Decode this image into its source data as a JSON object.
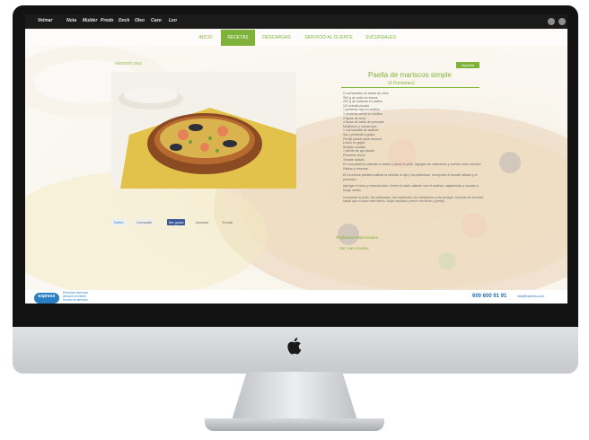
{
  "website": {
    "brands": [
      "Velmar",
      "Nota",
      "Mulder",
      "Prodo",
      "Dock",
      "Oleo",
      "Cazo",
      "Leo"
    ],
    "nav": [
      {
        "label": "INICIO",
        "active": false
      },
      {
        "label": "RECETAS",
        "active": true
      },
      {
        "label": "DESCARGAS",
        "active": false
      },
      {
        "label": "SERVICIO AL CLIENTE",
        "active": false
      },
      {
        "label": "SUCURSALES",
        "active": false
      }
    ],
    "date": "AGOSTO 2011",
    "print_label": "Imprimir",
    "recipe": {
      "title": "Paella de mariscos simple",
      "subtitle": "(4 Porciones)",
      "ingredients": [
        "5 cucharadas de aceite de oliva",
        "300 g de pollo en trozos",
        "200 g de calamar en anillos",
        "1/2 cebolla picada",
        "1 pimiento rojo en cubitos",
        "1 pimiento verde en cubitos",
        "2 tazas de arroz",
        "4 tazas de caldo de pescado",
        "Mejillones y camarones",
        "1 cucharadita de azafran",
        "Sal y pimienta a gusto",
        "Perejil picado para decorar",
        "Limon en gajos",
        "Arvejas cocidas",
        "1 diente de ajo picado",
        "Pimenton dulce",
        "Tomate rallado"
      ],
      "steps": [
        "En una paellera calentar el aceite y dorar el pollo. Agregar los calamares y cocinar unos minutos. Retirar y reservar.",
        "En la misma paellera saltear la cebolla, el ajo y los pimientos. Incorporar el tomate rallado y el pimenton.",
        "Agregar el arroz y mezclar bien. Verter el caldo caliente con el azafran, salpimentar y cocinar a fuego medio.",
        "Incorporar el pollo, los calamares, los mejillones, los camarones y las arvejas. Cocinar sin revolver hasta que el arroz este tierno. Dejar reposar y servir con limon y perejil."
      ]
    },
    "links": {
      "products": "Productos relacionados",
      "more": "Ver mas recetas"
    },
    "share": [
      "Twitter",
      "Compartir",
      "Me gusta",
      "Imprimir",
      "Enviar"
    ],
    "footer": {
      "logo": "express",
      "info": [
        "Direccion comercial",
        "Atencion al cliente",
        "Horario de atencion"
      ],
      "phone": "600 600 91 91",
      "email": "info@express.com"
    }
  },
  "colors": {
    "accent": "#7fb23a",
    "brand_blue": "#2a7fc2",
    "bezel": "#121212"
  }
}
